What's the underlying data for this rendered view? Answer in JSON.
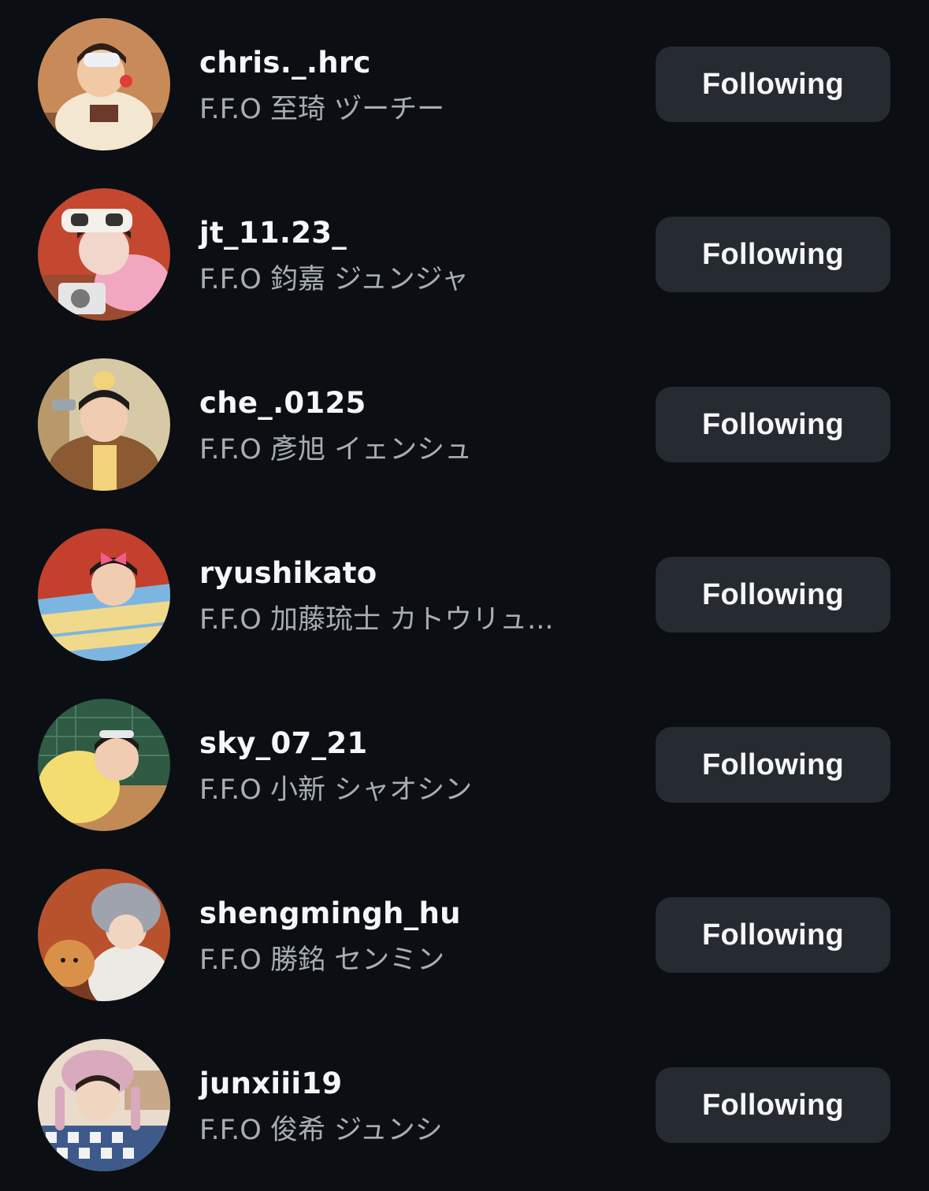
{
  "follow_list": {
    "rows": [
      {
        "username": "chris._.hrc",
        "full_name": "F.F.O 至琦 ヅーチー",
        "button_label": "Following",
        "avatar_colors": {
          "bg": "#c98a5a",
          "accent": "#f3e7d2",
          "detail": "#6b3a2a"
        }
      },
      {
        "username": "jt_11.23_",
        "full_name": "F.F.O 鈞嘉 ジュンジャ",
        "button_label": "Following",
        "avatar_colors": {
          "bg": "#c4472f",
          "accent": "#f1d6c9",
          "detail": "#f4f0ea"
        }
      },
      {
        "username": "che_.0125",
        "full_name": "F.F.O 彥旭  イェンシュ",
        "button_label": "Following",
        "avatar_colors": {
          "bg": "#d8c9a6",
          "accent": "#8b5a32",
          "detail": "#f2d27a"
        }
      },
      {
        "username": "ryushikato",
        "full_name": "F.F.O 加藤琉士 カトウリュ...",
        "button_label": "Following",
        "avatar_colors": {
          "bg": "#c2402c",
          "accent": "#7cb6e0",
          "detail": "#f0d98a"
        }
      },
      {
        "username": "sky_07_21",
        "full_name": "F.F.O 小新 シャオシン",
        "button_label": "Following",
        "avatar_colors": {
          "bg": "#2f5a44",
          "accent": "#f2dd6e",
          "detail": "#c28a55"
        }
      },
      {
        "username": "shengmingh_hu",
        "full_name": "F.F.O 勝銘 センミン",
        "button_label": "Following",
        "avatar_colors": {
          "bg": "#b8522c",
          "accent": "#eceae4",
          "detail": "#9ea3ad"
        }
      },
      {
        "username": "junxiii19",
        "full_name": "F.F.O 俊希 ジュンシ",
        "button_label": "Following",
        "avatar_colors": {
          "bg": "#e9dccd",
          "accent": "#d9a9bd",
          "detail": "#3d5a8a"
        }
      }
    ]
  }
}
